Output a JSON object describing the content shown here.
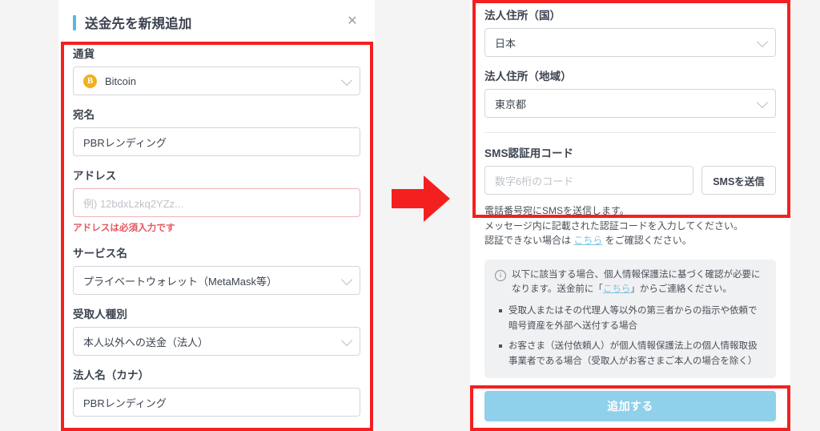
{
  "left_panel": {
    "title": "送金先を新規追加",
    "close_icon": "close-icon",
    "fields": {
      "currency": {
        "label": "通貨",
        "value": "Bitcoin",
        "coin_symbol": "B"
      },
      "recipient_name": {
        "label": "宛名",
        "value": "PBRレンディング"
      },
      "address": {
        "label": "アドレス",
        "value": "",
        "placeholder": "例) 12bdxLzkq2YZz...",
        "error": "アドレスは必須入力です"
      },
      "service_name": {
        "label": "サービス名",
        "value": "プライベートウォレット（MetaMask等）"
      },
      "recipient_type": {
        "label": "受取人種別",
        "value": "本人以外への送金（法人）"
      },
      "corporate_name_kana": {
        "label": "法人名（カナ）",
        "value": "PBRレンディング"
      }
    }
  },
  "right_panel": {
    "fields": {
      "corp_address_country": {
        "label": "法人住所（国）",
        "value": "日本"
      },
      "corp_address_region": {
        "label": "法人住所（地域）",
        "value": "東京都"
      },
      "sms_code": {
        "label": "SMS認証用コード",
        "value": "",
        "placeholder": "数字6桁のコード",
        "send_button": "SMSを送信"
      }
    },
    "note": {
      "line1": "電話番号宛にSMSを送信します。",
      "line2": "メッセージ内に記載された認証コードを入力してください。",
      "line3_before": "認証できない場合は ",
      "line3_link": "こちら",
      "line3_after": " をご確認ください。"
    },
    "info_box": {
      "icon": "info-icon",
      "head_before": "以下に該当する場合、個人情報保護法に基づく確認が必要になります。送金前に「",
      "head_link": "こちら",
      "head_after": "」からご連絡ください。",
      "items": [
        "受取人またはその代理人等以外の第三者からの指示や依頼で暗号資産を外部へ送付する場合",
        "お客さま（送付依頼人）が個人情報保護法上の個人情報取扱事業者である場合（受取人がお客さまご本人の場合を除く）"
      ]
    },
    "submit_button": "追加する"
  },
  "annotations": {
    "arrow_icon": "right-arrow-icon",
    "highlight_color": "#f42020"
  },
  "colors": {
    "accent_blue": "#5bb7e0",
    "submit_blue": "#8fd0ea",
    "error_red": "#e8555f",
    "coin_gold": "#f2b01e",
    "link_blue": "#7cc5e2"
  }
}
